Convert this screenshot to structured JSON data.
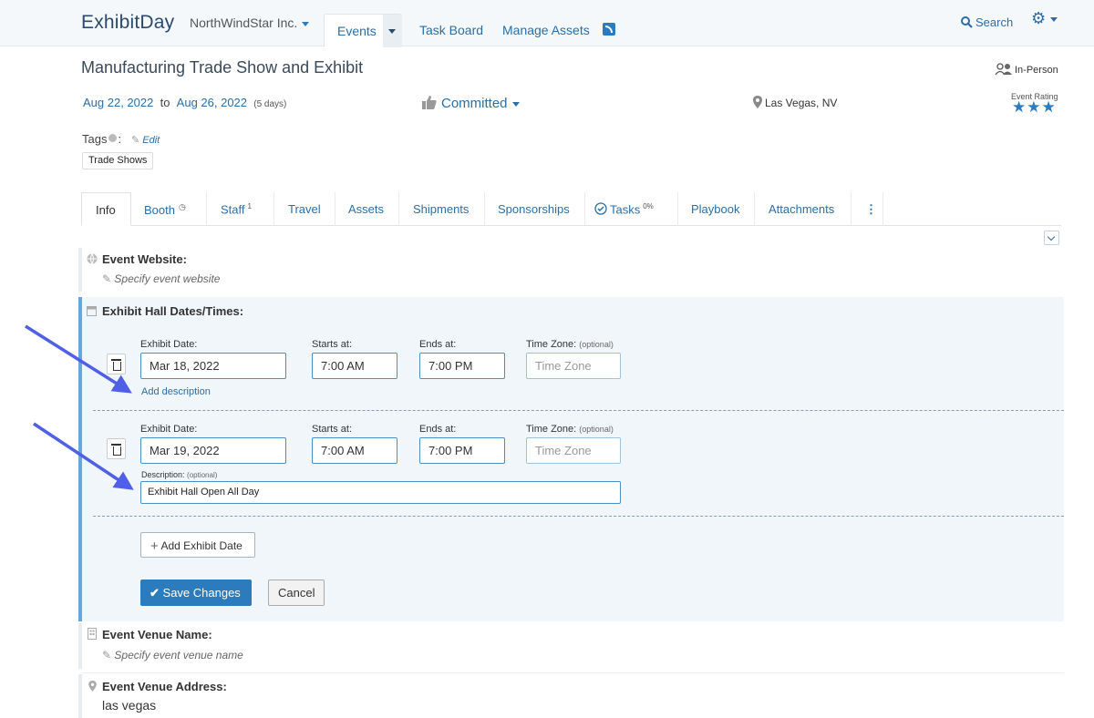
{
  "app": {
    "logo": "ExhibitDay",
    "org": "NorthWindStar Inc."
  },
  "nav": {
    "events": "Events",
    "task_board": "Task Board",
    "manage_assets": "Manage Assets",
    "search": "Search"
  },
  "event": {
    "title": "Manufacturing Trade Show and Exhibit",
    "format": "In-Person",
    "start_date": "Aug 22, 2022",
    "to": "to",
    "end_date": "Aug 26, 2022",
    "duration": "(5 days)",
    "status": "Committed",
    "location": "Las Vegas, NV",
    "rating_label": "Event Rating",
    "rating_stars": 3
  },
  "tags": {
    "label": "Tags",
    "colon": ":",
    "edit": "Edit",
    "items": [
      "Trade Shows"
    ]
  },
  "tabs": [
    {
      "label": "Info",
      "badge": ""
    },
    {
      "label": "Booth",
      "badge": ""
    },
    {
      "label": "Staff",
      "badge": "1"
    },
    {
      "label": "Travel",
      "badge": ""
    },
    {
      "label": "Assets",
      "badge": ""
    },
    {
      "label": "Shipments",
      "badge": ""
    },
    {
      "label": "Sponsorships",
      "badge": ""
    },
    {
      "label": "Tasks",
      "badge": "0%"
    },
    {
      "label": "Playbook",
      "badge": ""
    },
    {
      "label": "Attachments",
      "badge": ""
    }
  ],
  "website": {
    "label": "Event Website:",
    "hint": "Specify event website"
  },
  "hall": {
    "label": "Exhibit Hall Dates/Times:",
    "field_labels": {
      "date": "Exhibit Date:",
      "starts": "Starts at:",
      "ends": "Ends at:",
      "tz": "Time Zone:",
      "optional": "(optional)",
      "description": "Description:"
    },
    "entries": [
      {
        "date": "Mar 18, 2022",
        "starts": "7:00 AM",
        "ends": "7:00 PM",
        "tz_placeholder": "Time Zone",
        "add_description": "Add description"
      },
      {
        "date": "Mar 19, 2022",
        "starts": "7:00 AM",
        "ends": "7:00 PM",
        "tz_placeholder": "Time Zone",
        "description": "Exhibit Hall Open All Day"
      }
    ],
    "add_date": "Add Exhibit Date",
    "save": "Save Changes",
    "cancel": "Cancel"
  },
  "venue": {
    "label": "Event Venue Name:",
    "hint": "Specify event venue name"
  },
  "address": {
    "label": "Event Venue Address:",
    "value": "las vegas"
  },
  "colors": {
    "accent": "#2b7bbd",
    "panel": "#f1f6fb",
    "arrow": "#4f5fe8"
  }
}
